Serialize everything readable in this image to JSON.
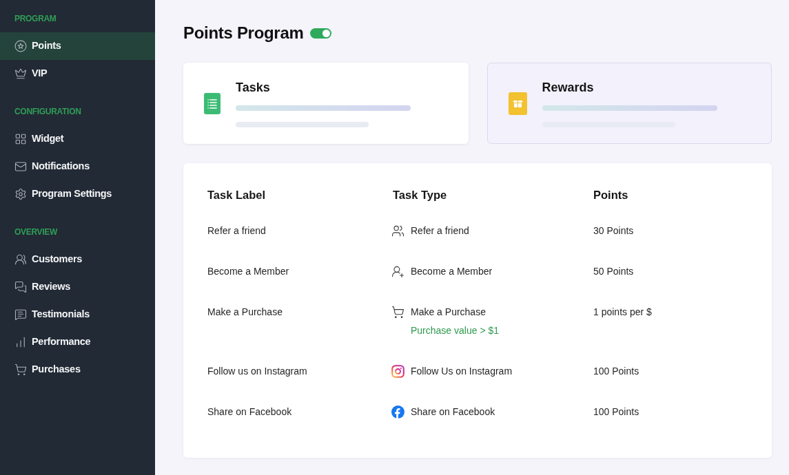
{
  "sidebar": {
    "sections": [
      {
        "heading": "PROGRAM",
        "items": [
          {
            "label": "Points",
            "selected": true
          },
          {
            "label": "VIP",
            "selected": false
          }
        ]
      },
      {
        "heading": "CONFIGURATION",
        "items": [
          {
            "label": "Widget",
            "selected": false
          },
          {
            "label": "Notifications",
            "selected": false
          },
          {
            "label": "Program Settings",
            "selected": false
          }
        ]
      },
      {
        "heading": "OVERVIEW",
        "items": [
          {
            "label": "Customers",
            "selected": false
          },
          {
            "label": "Reviews",
            "selected": false
          },
          {
            "label": "Testimonials",
            "selected": false
          },
          {
            "label": "Performance",
            "selected": false
          },
          {
            "label": "Purchases",
            "selected": false
          }
        ]
      }
    ]
  },
  "header": {
    "title": "Points Program",
    "toggle": {
      "on": true
    }
  },
  "cards": [
    {
      "title": "Tasks",
      "selected": true
    },
    {
      "title": "Rewards",
      "selected": false
    }
  ],
  "table": {
    "columns": [
      "Task Label",
      "Task Type",
      "Points"
    ],
    "rows": [
      {
        "label": "Refer a friend",
        "type": "Refer a friend",
        "points": "30 Points"
      },
      {
        "label": "Become a Member",
        "type": "Become a Member",
        "points": "50 Points"
      },
      {
        "label": "Make a Purchase",
        "type": "Make a Purchase",
        "condition": "Purchase value > $1",
        "points": "1 points per $"
      },
      {
        "label": "Follow us on Instagram",
        "type": "Follow Us on Instagram",
        "points": "100 Points"
      },
      {
        "label": "Share on Facebook",
        "type": "Share on Facebook",
        "points": "100 Points"
      }
    ]
  }
}
